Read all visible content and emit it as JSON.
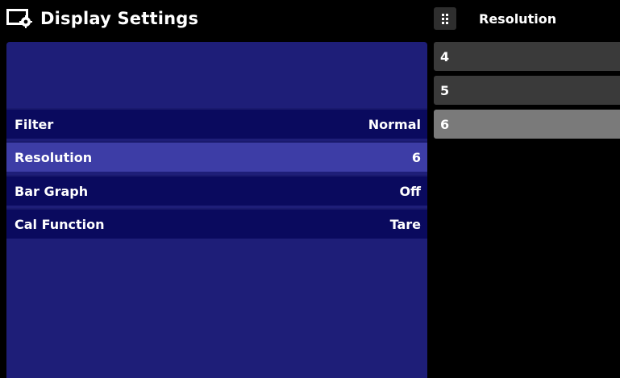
{
  "header": {
    "title": "Display Settings",
    "icon": "display-settings-icon"
  },
  "settings": [
    {
      "label": "Filter",
      "value": "Normal",
      "selected": false
    },
    {
      "label": "Resolution",
      "value": "6",
      "selected": true
    },
    {
      "label": "Bar Graph",
      "value": "Off",
      "selected": false
    },
    {
      "label": "Cal Function",
      "value": "Tare",
      "selected": false
    }
  ],
  "popup": {
    "title": "Resolution",
    "icon": "grid-menu-icon",
    "options": [
      {
        "label": "4",
        "selected": false
      },
      {
        "label": "5",
        "selected": false
      },
      {
        "label": "6",
        "selected": true
      }
    ]
  },
  "colors": {
    "panel": "#1e1e78",
    "row": "#0a0a5e",
    "row_selected": "#3d3da6",
    "option": "#3a3a3a",
    "option_selected": "#7a7a7a"
  }
}
